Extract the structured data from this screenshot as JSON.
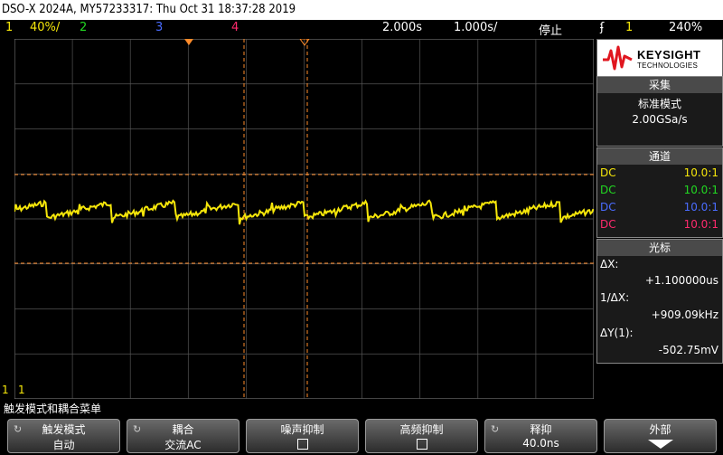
{
  "title": "DSO-X 2024A, MY57233317: Thu Oct 31 18:37:28 2019",
  "topbar": {
    "ch1": "1",
    "ch1_scale": "40%/",
    "ch2": "2",
    "ch3": "3",
    "ch4": "4",
    "timebase": "2.000s",
    "time_per_div": "1.000s/",
    "run_state": "停止",
    "trigger_icon": "trigger-edge-icon",
    "trig_ch": "1",
    "trig_level": "240%"
  },
  "colors": {
    "ch1": "#f5e60a",
    "ch2": "#22d822",
    "ch3": "#4a6cff",
    "ch4": "#ff2a6d",
    "cursor": "#ff8c2a"
  },
  "logo": {
    "brand": "KEYSIGHT",
    "sub": "TECHNOLOGIES"
  },
  "acquire": {
    "head": "采集",
    "mode": "标准模式",
    "rate": "2.00GSa/s"
  },
  "channels": {
    "head": "通道",
    "rows": [
      {
        "coupling": "DC",
        "ratio": "10.0:1"
      },
      {
        "coupling": "DC",
        "ratio": "10.0:1"
      },
      {
        "coupling": "DC",
        "ratio": "10.0:1"
      },
      {
        "coupling": "DC",
        "ratio": "10.0:1"
      }
    ]
  },
  "cursors": {
    "head": "光标",
    "dx_label": "ΔX:",
    "dx": "+1.100000us",
    "inv_label": "1/ΔX:",
    "inv": "+909.09kHz",
    "dy_label": "ΔY(1):",
    "dy": "-502.75mV"
  },
  "ground_marker": "1",
  "status_line": "触发模式和耦合菜单",
  "softkeys": [
    {
      "label": "触发模式",
      "value": "自动"
    },
    {
      "label": "耦合",
      "value": "交流AC"
    },
    {
      "label": "噪声抑制",
      "value": ""
    },
    {
      "label": "高频抑制",
      "value": ""
    },
    {
      "label": "释抑",
      "value": "40.0ns"
    },
    {
      "label": "外部",
      "value": ""
    }
  ]
}
